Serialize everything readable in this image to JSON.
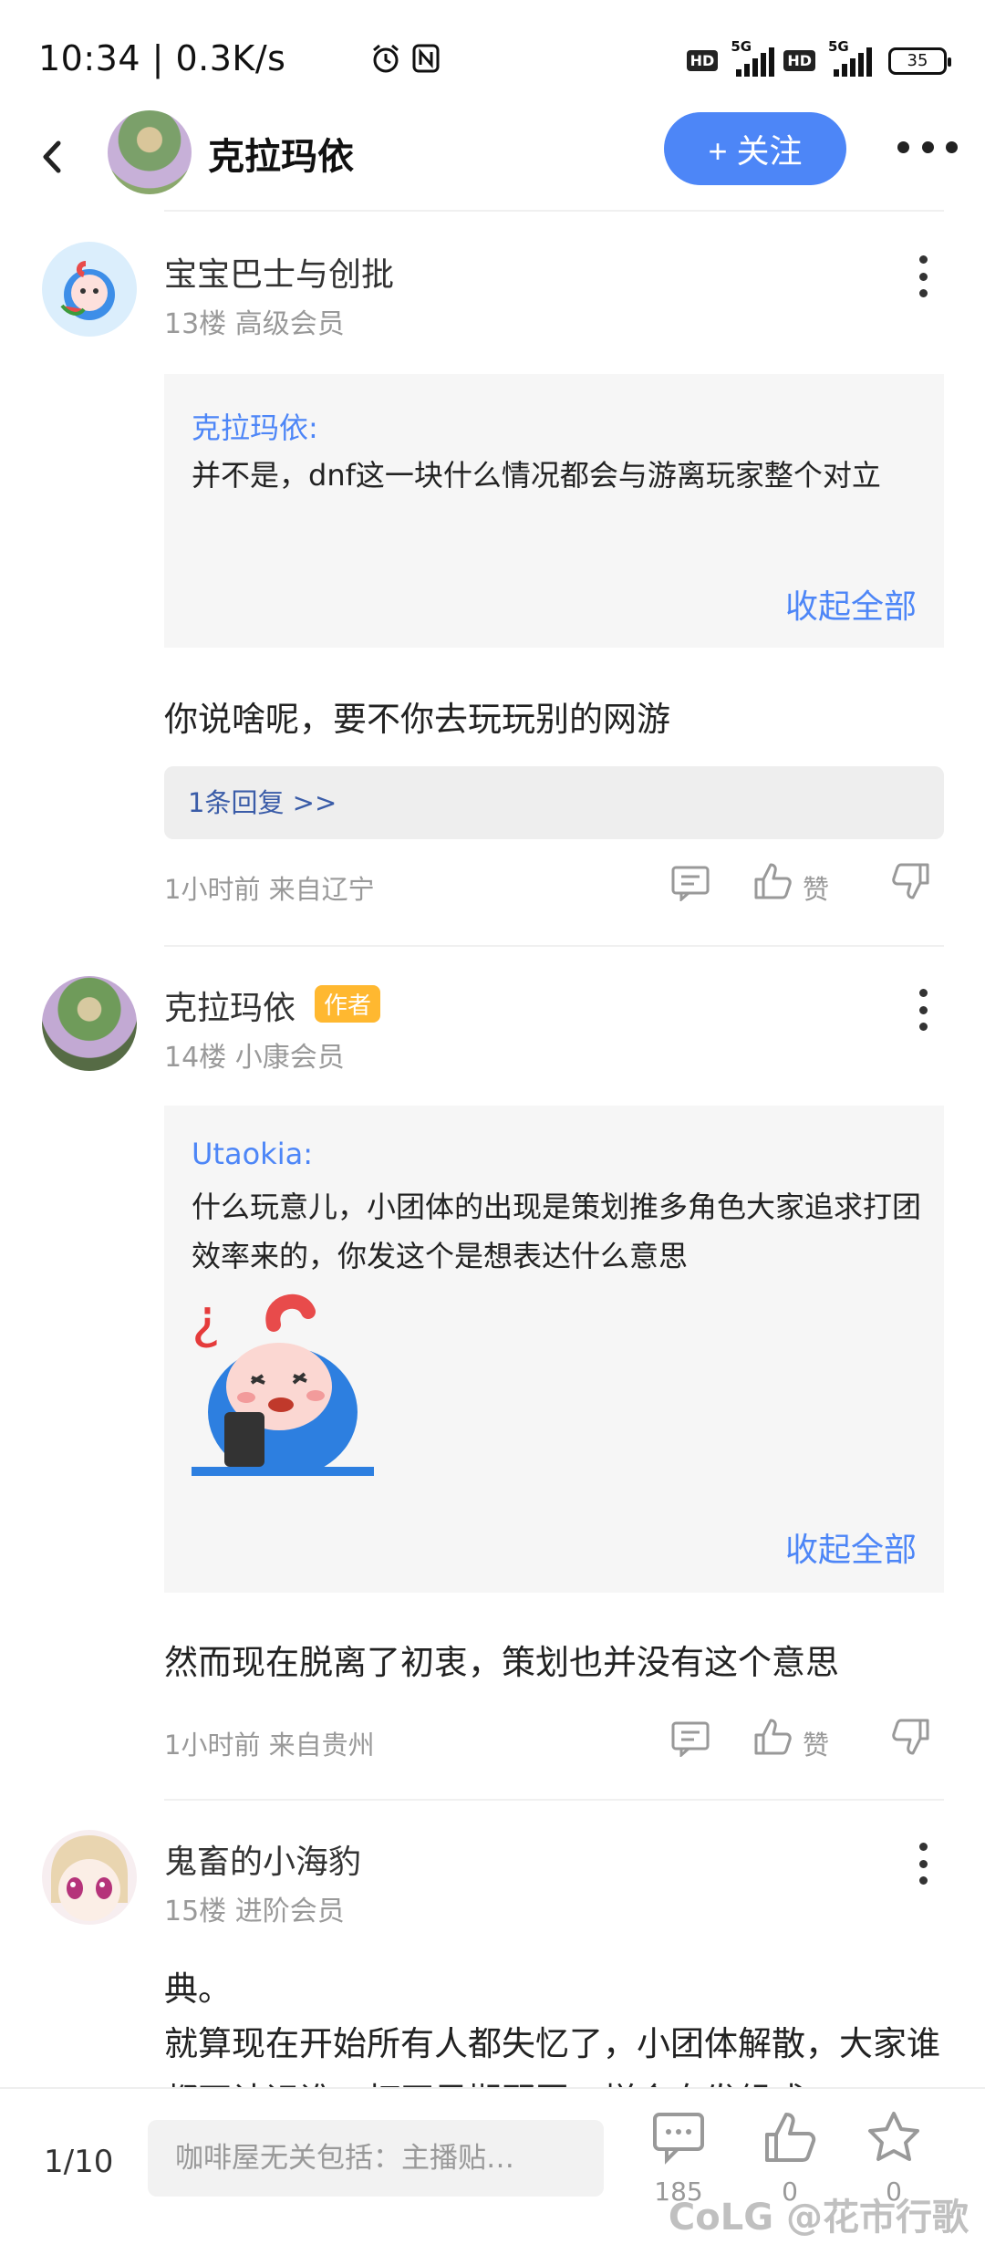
{
  "status_bar": {
    "time": "10:34 | 0.3K/s",
    "network": "5G",
    "hd": "HD",
    "battery": "35"
  },
  "header": {
    "title": "克拉玛依",
    "follow_label": "+ 关注"
  },
  "posts": [
    {
      "user": "宝宝巴士与创批",
      "floor": "13楼  高级会员",
      "quote_user": "克拉玛依:",
      "quote_text": "并不是，dnf这一块什么情况都会与游离玩家整个对立",
      "collapse": "收起全部",
      "content": "你说啥呢，要不你去玩玩别的网游",
      "replies": "1条回复 >>",
      "meta": "1小时前  来自辽宁",
      "like_label": "赞"
    },
    {
      "user": "克拉玛依",
      "badge": "作者",
      "floor": "14楼  小康会员",
      "quote_user": "Utaokia:",
      "quote_text": "什么玩意儿，小团体的出现是策划推多角色大家追求打团效率来的，你发这个是想表达什么意思",
      "collapse": "收起全部",
      "content": "然而现在脱离了初衷，策划也并没有这个意思",
      "meta": "1小时前  来自贵州",
      "like_label": "赞"
    },
    {
      "user": "鬼畜的小海豹",
      "floor": "15楼  进阶会员",
      "content_line1": "典。",
      "content_line2": "就算现在开始所有人都失忆了，小团体解散，大家谁都不认识谁，打开局期野团，样合自发组成"
    }
  ],
  "bottom_bar": {
    "page": "1/10",
    "input_placeholder": "咖啡屋无关包括：主播贴…",
    "comment_count": "185",
    "like_count": "0",
    "star_count": "0",
    "watermark": "CoLG @花市行歌"
  },
  "colors": {
    "accent": "#4d86f7",
    "author_badge": "#ffb830"
  }
}
